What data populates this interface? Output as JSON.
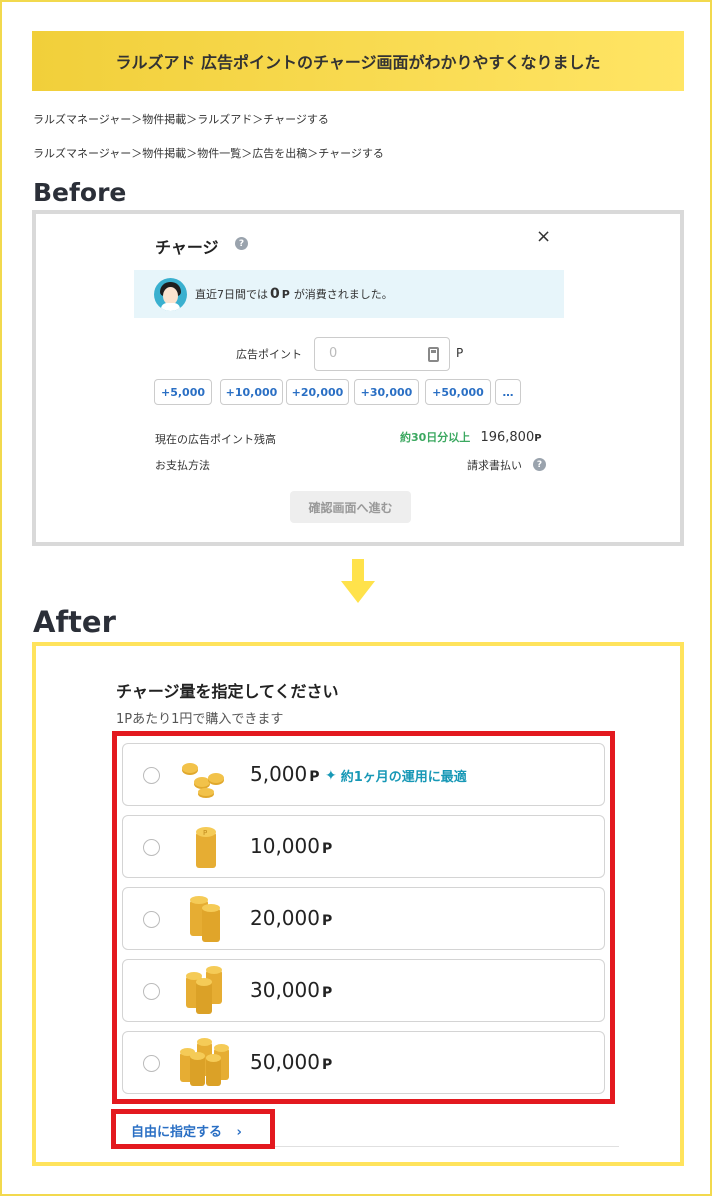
{
  "banner": {
    "title": "ラルズアド 広告ポイントのチャージ画面がわかりやすくなりました"
  },
  "breadcrumbs": [
    "ラルズマネージャー＞物件掲載＞ラルズアド＞チャージする",
    "ラルズマネージャー＞物件掲載＞物件一覧＞広告を出稿＞チャージする"
  ],
  "before": {
    "section_label": "Before",
    "dialog_title": "チャージ",
    "help": "?",
    "close": "×",
    "notice_prefix": "直近7日間では",
    "notice_value": "0",
    "notice_unit": "P",
    "notice_suffix": "が消費されました。",
    "point_label": "広告ポイント",
    "point_placeholder": "0",
    "point_unit": "P",
    "chips": [
      "+5,000",
      "+10,000",
      "+20,000",
      "+30,000",
      "+50,000",
      "…"
    ],
    "balance_label": "現在の広告ポイント残高",
    "balance_hint": "約30日分以上",
    "balance_value": "196,800",
    "balance_unit": "P",
    "payment_label": "お支払方法",
    "payment_value": "請求書払い",
    "confirm_button": "確認画面へ進む"
  },
  "after": {
    "section_label": "After",
    "title": "チャージ量を指定してください",
    "subtitle": "1Pあたり1円で購入できます",
    "unit": "P",
    "options": [
      {
        "amount": "5,000",
        "badge": "約1ヶ月の運用に最適",
        "selected": false
      },
      {
        "amount": "10,000",
        "selected": false
      },
      {
        "amount": "20,000",
        "selected": false
      },
      {
        "amount": "30,000",
        "selected": false
      },
      {
        "amount": "50,000",
        "selected": false
      }
    ],
    "free_link": "自由に指定する",
    "free_link_chevron": "›"
  },
  "colors": {
    "accent_yellow": "#ffe35c",
    "highlight_red": "#e3191f",
    "link_blue": "#2a6fc4",
    "teal": "#1798b6",
    "green": "#3ba860"
  }
}
